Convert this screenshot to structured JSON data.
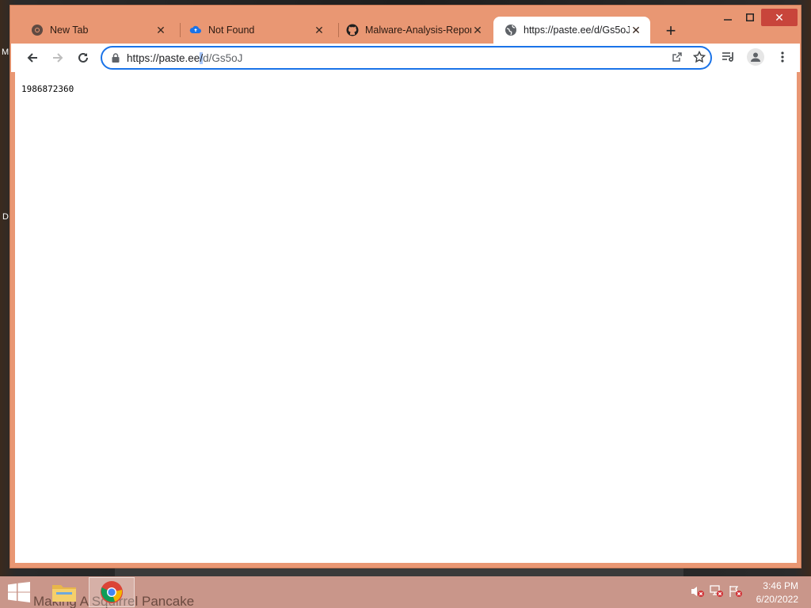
{
  "desktop": {
    "edge_letter_top": "M",
    "edge_letter_mid": "D"
  },
  "browser": {
    "tabs": [
      {
        "title": "New Tab",
        "icon": "chrome-icon",
        "active": false
      },
      {
        "title": "Not Found",
        "icon": "cloud-upload-icon",
        "active": false
      },
      {
        "title": "Malware-Analysis-Reports",
        "icon": "github-icon",
        "active": false
      },
      {
        "title": "https://paste.ee/d/Gs5oJ",
        "icon": "globe-icon",
        "active": true
      }
    ],
    "new_tab_label": "+",
    "omnibox": {
      "url_host": "https://paste.ee",
      "url_caret": "/",
      "url_path": "d/Gs5oJ"
    }
  },
  "page": {
    "body_text": "1986872360"
  },
  "taskbar": {
    "video_caption": "Making A Squirrel Pancake",
    "clock_time": "3:46 PM",
    "clock_date": "6/20/2022"
  },
  "colors": {
    "frame": "#e99773",
    "focus_ring": "#1a73e8",
    "taskbar": "#c9968a",
    "close_button": "#c8453b"
  }
}
